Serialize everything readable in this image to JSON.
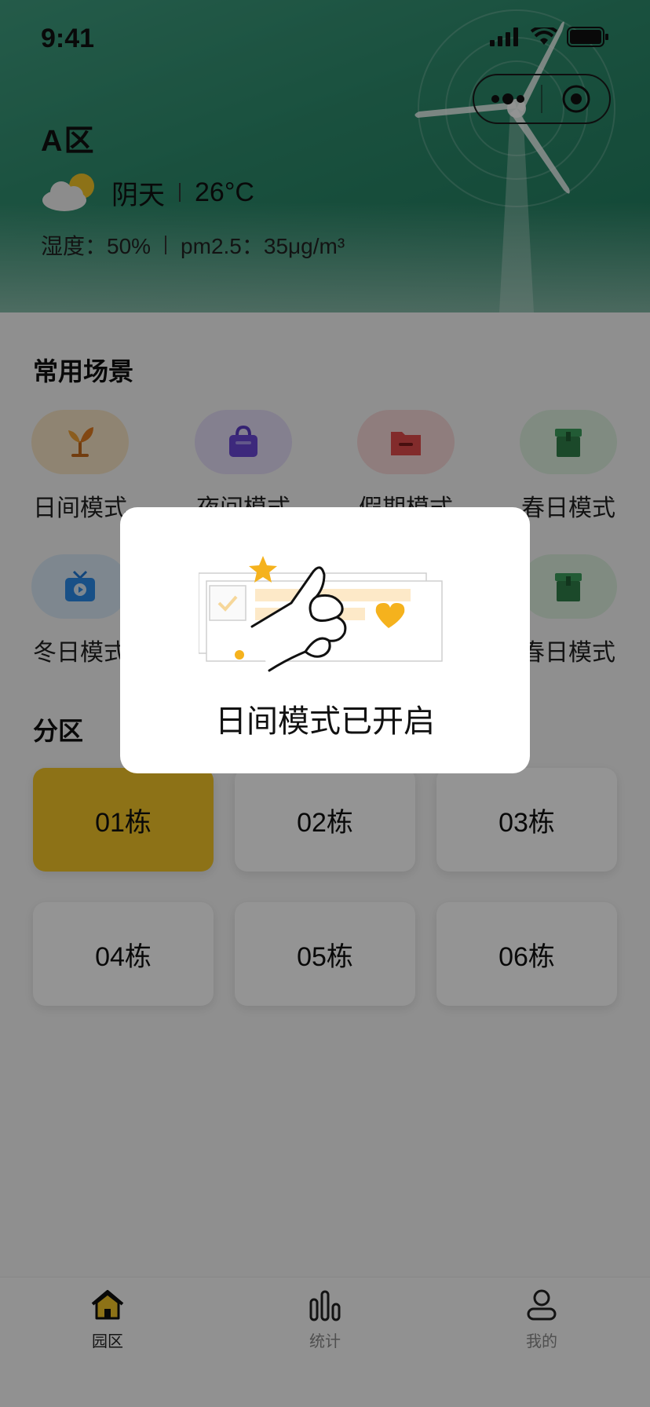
{
  "status": {
    "time": "9:41"
  },
  "header": {
    "zone": "A区",
    "weather": {
      "condition": "阴天",
      "temperature": "26°C"
    },
    "humidity": "湿度：50%",
    "pm25": "pm2.5：35μg/m³"
  },
  "scenes": {
    "title": "常用场景",
    "items": [
      {
        "label": "日间模式",
        "icon": "sprout-icon",
        "color": "#f6e3c4"
      },
      {
        "label": "夜间模式",
        "icon": "bag-icon",
        "color": "#e4dcf6"
      },
      {
        "label": "假期模式",
        "icon": "folder-icon",
        "color": "#f7d7d7"
      },
      {
        "label": "春日模式",
        "icon": "box-icon",
        "color": "#dcefdf"
      },
      {
        "label": "冬日模式",
        "icon": "tv-icon",
        "color": "#d9e9f7"
      },
      {
        "label": "春日模式",
        "icon": "box-icon",
        "color": "#dcefdf"
      }
    ]
  },
  "partition": {
    "title": "分区",
    "buildings": [
      "01栋",
      "02栋",
      "03栋",
      "04栋",
      "05栋",
      "06栋"
    ],
    "active": "01栋",
    "accent": "#f3c528"
  },
  "tabbar": {
    "items": [
      {
        "label": "园区",
        "icon": "home-icon",
        "active": true
      },
      {
        "label": "统计",
        "icon": "bar-chart-icon",
        "active": false
      },
      {
        "label": "我的",
        "icon": "user-icon",
        "active": false
      }
    ]
  },
  "modal": {
    "message": "日间模式已开启"
  }
}
